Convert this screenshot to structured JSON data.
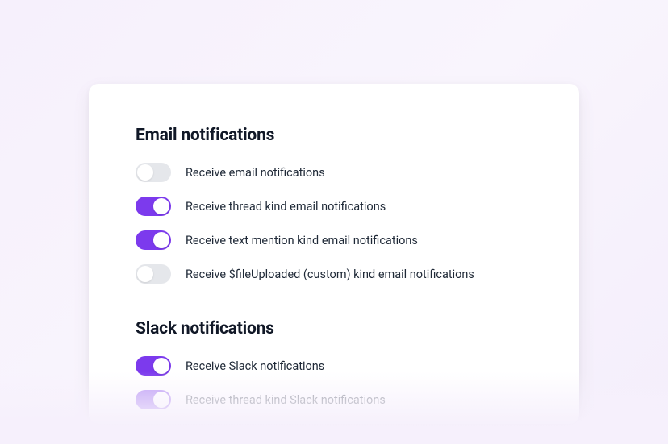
{
  "sections": {
    "email": {
      "title": "Email notifications",
      "items": [
        {
          "label": "Receive email notifications",
          "on": false
        },
        {
          "label": "Receive thread kind email notifications",
          "on": true
        },
        {
          "label": "Receive text mention kind email notifications",
          "on": true
        },
        {
          "label": "Receive $fileUploaded (custom) kind email notifications",
          "on": false
        }
      ]
    },
    "slack": {
      "title": "Slack notifications",
      "items": [
        {
          "label": "Receive Slack notifications",
          "on": true
        },
        {
          "label": "Receive thread kind Slack notifications",
          "on": true
        }
      ]
    }
  },
  "colors": {
    "accent": "#7c3aed",
    "toggle_off": "#e5e7eb",
    "text": "#1f2937",
    "heading": "#111827"
  }
}
